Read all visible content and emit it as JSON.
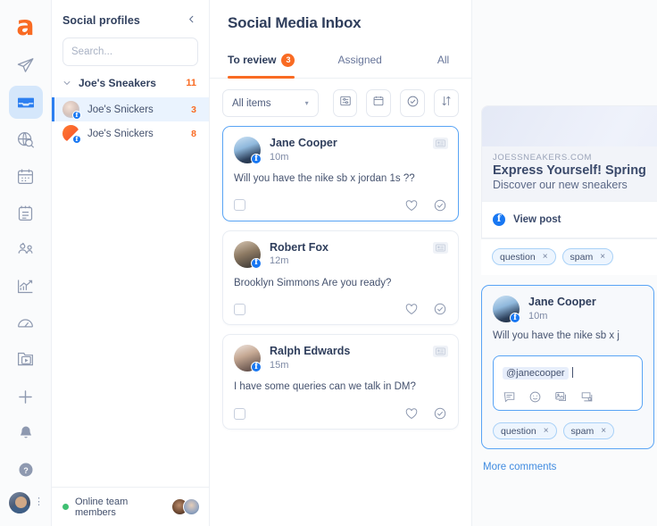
{
  "rail": {
    "logo": "a",
    "items": [
      {
        "name": "publish-icon",
        "label": "Publish"
      },
      {
        "name": "inbox-icon",
        "label": "Inbox",
        "active": true
      },
      {
        "name": "monitoring-icon",
        "label": "Monitoring"
      },
      {
        "name": "calendar-icon",
        "label": "Calendar"
      },
      {
        "name": "tasks-icon",
        "label": "Tasks"
      },
      {
        "name": "team-icon",
        "label": "Team"
      },
      {
        "name": "analytics-icon",
        "label": "Analytics"
      },
      {
        "name": "performance-icon",
        "label": "Performance"
      },
      {
        "name": "media-library-icon",
        "label": "Media library"
      },
      {
        "name": "add-icon",
        "label": "Add"
      },
      {
        "name": "notifications-icon",
        "label": "Notifications"
      },
      {
        "name": "help-icon",
        "label": "Help"
      }
    ]
  },
  "sidebar": {
    "title": "Social profiles",
    "collapse_label": "‹",
    "search": {
      "placeholder": "Search...",
      "value": ""
    },
    "group": {
      "name": "Joe's Sneakers",
      "count": "11"
    },
    "profiles": [
      {
        "name": "Joe's Snickers",
        "count": "3",
        "network": "facebook",
        "selected": true
      },
      {
        "name": "Joe's Snickers",
        "count": "8",
        "network": "facebook",
        "selected": false
      }
    ],
    "online": {
      "label": "Online team members"
    }
  },
  "inbox": {
    "title": "Social Media Inbox",
    "tabs": [
      {
        "label": "To review",
        "badge": "3",
        "active": true
      },
      {
        "label": "Assigned",
        "badge": "",
        "active": false
      },
      {
        "label": "All",
        "badge": "",
        "active": false
      }
    ],
    "filter": {
      "selected": "All items",
      "caret": "▾"
    },
    "toolbar": [
      {
        "name": "filters-icon",
        "label": "Filters"
      },
      {
        "name": "date-range-icon",
        "label": "Date range"
      },
      {
        "name": "status-icon",
        "label": "Status"
      },
      {
        "name": "sort-icon",
        "label": "Sort"
      }
    ],
    "messages": [
      {
        "author": "Jane Cooper",
        "time": "10m",
        "text": "Will you have the nike sb x jordan 1s ??",
        "network": "facebook",
        "type": "comment",
        "active": true
      },
      {
        "author": "Robert Fox",
        "time": "12m",
        "text": "Brooklyn Simmons Are you ready?",
        "network": "facebook",
        "type": "comment",
        "active": false
      },
      {
        "author": "Ralph Edwards",
        "time": "15m",
        "text": "I have some queries can we talk in DM?",
        "network": "facebook",
        "type": "comment",
        "active": false
      }
    ]
  },
  "preview": {
    "link": {
      "domain": "JOESSNEAKERS.COM",
      "headline": "Express Yourself! Spring",
      "subhead": "Discover our new sneakers"
    },
    "view_post": {
      "label": "View post",
      "network": "facebook"
    },
    "post_tags": [
      {
        "label": "question",
        "remove": "×"
      },
      {
        "label": "spam",
        "remove": "×"
      }
    ],
    "comment": {
      "author": "Jane Cooper",
      "time": "10m",
      "text": "Will you have the nike sb x j",
      "network": "facebook"
    },
    "reply": {
      "mention": "@janecooper",
      "value": "",
      "icons": [
        {
          "name": "saved-replies-icon",
          "label": "Saved replies"
        },
        {
          "name": "emoji-icon",
          "label": "Emoji"
        },
        {
          "name": "image-icon",
          "label": "Image"
        },
        {
          "name": "gif-icon",
          "label": "GIF"
        }
      ]
    },
    "comment_tags": [
      {
        "label": "question",
        "remove": "×"
      },
      {
        "label": "spam",
        "remove": "×"
      }
    ],
    "more_comments": "More comments"
  },
  "colors": {
    "accent_orange": "#f96b23",
    "accent_blue": "#2d7ff0",
    "facebook_blue": "#1877f2",
    "text_dark": "#2f3e5c",
    "online_green": "#3fc072"
  }
}
